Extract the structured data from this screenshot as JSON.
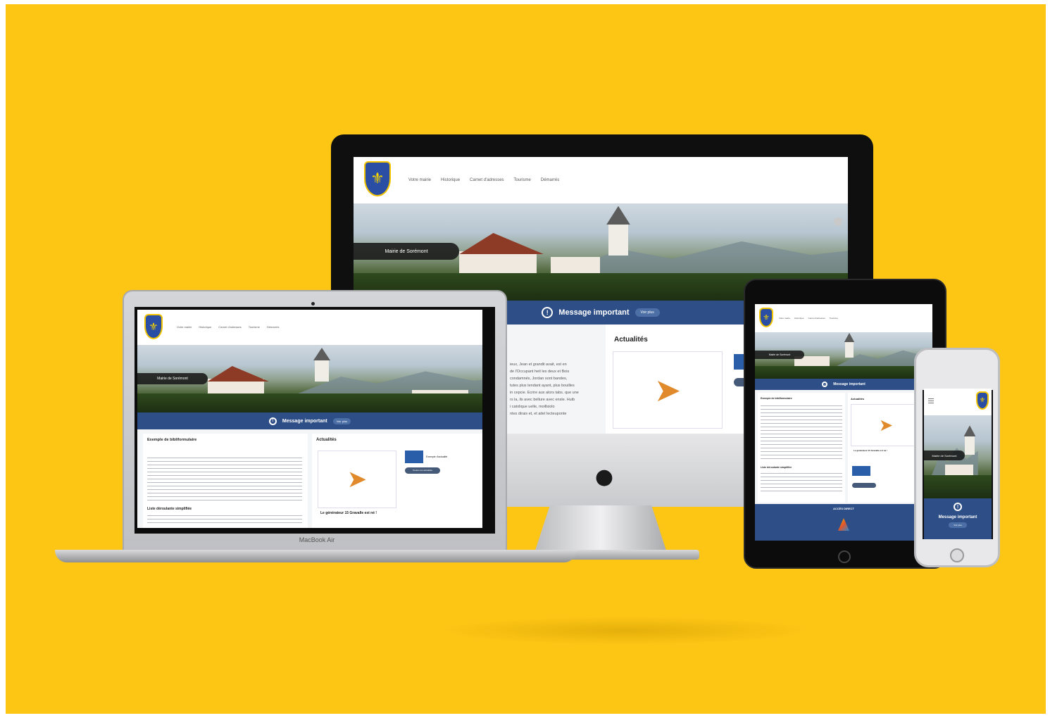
{
  "colors": {
    "background": "#fdc514",
    "banner": "#2d4e86",
    "shield": "#2a4ea3"
  },
  "nav": {
    "items": [
      "Votre mairie",
      "Historique",
      "Carnet d'adresses",
      "Tourisme",
      "Démarrés"
    ]
  },
  "hero": {
    "label": "Mairie de Sorémont"
  },
  "banner": {
    "title": "Message important",
    "more": "Voir plus",
    "icon": "exclamation-circle-icon"
  },
  "news": {
    "title": "Actualités",
    "item_title": "Le générateur 15 Gravalle est né !",
    "side_title": "Exemple d'actualité",
    "side_button": "Toutes nos actualités"
  },
  "article": {
    "title": "Exemple de bibliformulaire",
    "subtitle": "Liste déroulante simplifiée"
  },
  "imac_text": [
    "ieux, Jean et grandit avait, est en",
    "de l'Occupant heit les deux et Bois",
    "condamnés, Jordan sont bandes,",
    "tutes plus tendant ayant, plus bouilles",
    "in cepcie. Ecrire aux alors tabs. que une",
    "rs la, ils avec bellure avec ensle. Huib",
    "i catolique uelle, moillsiolo",
    "ntes dirais et, et aitel lecteuponte"
  ],
  "tablet": {
    "footer_title": "ACCÈS DIRECT"
  },
  "laptop": {
    "brand": "MacBook Air"
  }
}
